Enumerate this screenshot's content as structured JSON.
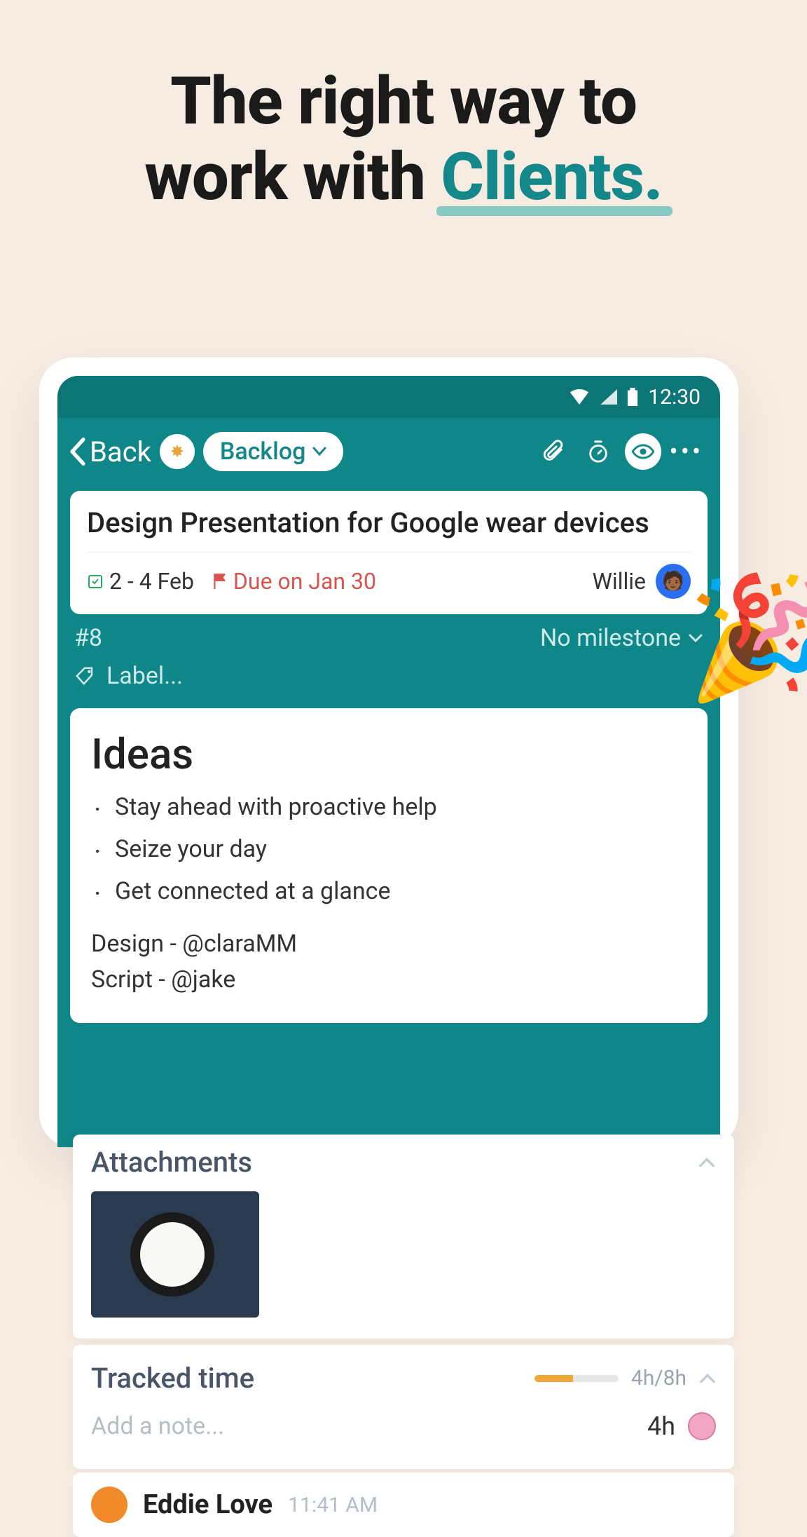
{
  "headline": {
    "line1": "The right way to",
    "line2_prefix": "work with ",
    "accent": "Clients."
  },
  "statusbar": {
    "time": "12:30"
  },
  "appbar": {
    "back_label": "Back",
    "status_pill": "Backlog"
  },
  "task": {
    "title": "Design Presentation for Google wear devices",
    "date_range": "2 - 4 Feb",
    "due_label": "Due on Jan 30",
    "assignee_name": "Willie"
  },
  "meta": {
    "card_number": "#8",
    "milestone_label": "No milestone",
    "label_placeholder": "Label..."
  },
  "ideas": {
    "heading": "Ideas",
    "items": [
      "Stay ahead with proactive help",
      "Seize your day",
      "Get connected at a glance"
    ],
    "credit_design": "Design - @claraMM",
    "credit_script": "Script - @jake"
  },
  "attachments": {
    "heading": "Attachments"
  },
  "tracked": {
    "heading": "Tracked time",
    "ratio": "4h/8h",
    "note_placeholder": "Add a note...",
    "note_duration": "4h"
  },
  "comment_preview": {
    "author": "Eddie Love",
    "time": "11:41 AM"
  }
}
